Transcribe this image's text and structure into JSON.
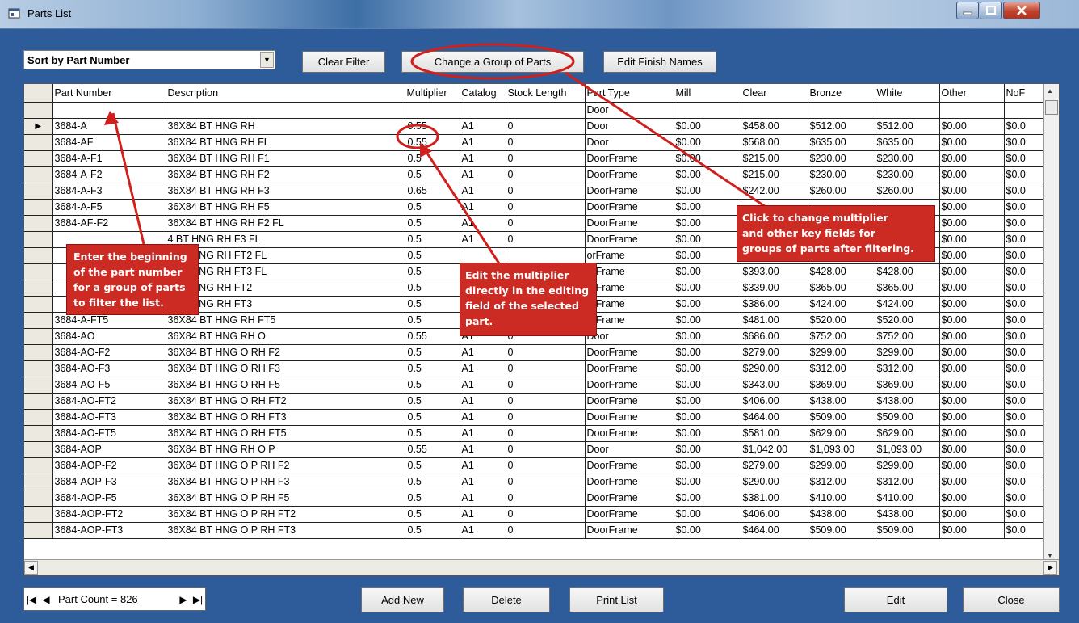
{
  "window": {
    "title": "Parts List"
  },
  "toolbar": {
    "sort_selected": "Sort by Part Number",
    "clear_filter": "Clear Filter",
    "change_group": "Change a Group of Parts",
    "edit_finish": "Edit Finish Names"
  },
  "grid": {
    "columns": [
      "Part Number",
      "Description",
      "Multiplier",
      "Catalog",
      "Stock Length",
      "Part Type",
      "Mill",
      "Clear",
      "Bronze",
      "White",
      "Other",
      "NoF"
    ],
    "filter_values": [
      "",
      "",
      "",
      "",
      "",
      "Door",
      "",
      "",
      "",
      "",
      "",
      ""
    ],
    "rows": [
      [
        "3684-A",
        "36X84 BT HNG RH",
        "0.55",
        "A1",
        "0",
        "Door",
        "$0.00",
        "$458.00",
        "$512.00",
        "$512.00",
        "$0.00",
        "$0.0"
      ],
      [
        "3684-AF",
        "36X84 BT HNG RH FL",
        "0.55",
        "A1",
        "0",
        "Door",
        "$0.00",
        "$568.00",
        "$635.00",
        "$635.00",
        "$0.00",
        "$0.0"
      ],
      [
        "3684-A-F1",
        "36X84 BT HNG RH F1",
        "0.5",
        "A1",
        "0",
        "DoorFrame",
        "$0.00",
        "$215.00",
        "$230.00",
        "$230.00",
        "$0.00",
        "$0.0"
      ],
      [
        "3684-A-F2",
        "36X84 BT HNG RH F2",
        "0.5",
        "A1",
        "0",
        "DoorFrame",
        "$0.00",
        "$215.00",
        "$230.00",
        "$230.00",
        "$0.00",
        "$0.0"
      ],
      [
        "3684-A-F3",
        "36X84 BT HNG RH F3",
        "0.65",
        "A1",
        "0",
        "DoorFrame",
        "$0.00",
        "$242.00",
        "$260.00",
        "$260.00",
        "$0.00",
        "$0.0"
      ],
      [
        "3684-A-F5",
        "36X84 BT HNG RH F5",
        "0.5",
        "A1",
        "0",
        "DoorFrame",
        "$0.00",
        "",
        "",
        "",
        "$0.00",
        "$0.0"
      ],
      [
        "3684-AF-F2",
        "36X84 BT HNG RH F2 FL",
        "0.5",
        "A1",
        "0",
        "DoorFrame",
        "$0.00",
        "",
        "",
        "",
        "$0.00",
        "$0.0"
      ],
      [
        "",
        "4 BT HNG RH F3 FL",
        "0.5",
        "A1",
        "0",
        "DoorFrame",
        "$0.00",
        "",
        "",
        "",
        "$0.00",
        "$0.0"
      ],
      [
        "",
        "4 BT HNG RH FT2 FL",
        "0.5",
        "",
        "",
        "orFrame",
        "$0.00",
        "$342.00",
        "$369.00",
        "$369.00",
        "$0.00",
        "$0.0"
      ],
      [
        "",
        "4 BT HNG RH FT3 FL",
        "0.5",
        "",
        "",
        "orFrame",
        "$0.00",
        "$393.00",
        "$428.00",
        "$428.00",
        "$0.00",
        "$0.0"
      ],
      [
        "",
        "4 BT HNG RH FT2",
        "0.5",
        "",
        "",
        "orFrame",
        "$0.00",
        "$339.00",
        "$365.00",
        "$365.00",
        "$0.00",
        "$0.0"
      ],
      [
        "",
        "4 BT HNG RH FT3",
        "0.5",
        "",
        "",
        "orFrame",
        "$0.00",
        "$386.00",
        "$424.00",
        "$424.00",
        "$0.00",
        "$0.0"
      ],
      [
        "3684-A-FT5",
        "36X84 BT HNG RH FT5",
        "0.5",
        "",
        "",
        "orFrame",
        "$0.00",
        "$481.00",
        "$520.00",
        "$520.00",
        "$0.00",
        "$0.0"
      ],
      [
        "3684-AO",
        "36X84 BT HNG RH O",
        "0.55",
        "A1",
        "0",
        "Door",
        "$0.00",
        "$686.00",
        "$752.00",
        "$752.00",
        "$0.00",
        "$0.0"
      ],
      [
        "3684-AO-F2",
        "36X84 BT HNG O RH F2",
        "0.5",
        "A1",
        "0",
        "DoorFrame",
        "$0.00",
        "$279.00",
        "$299.00",
        "$299.00",
        "$0.00",
        "$0.0"
      ],
      [
        "3684-AO-F3",
        "36X84 BT HNG O RH F3",
        "0.5",
        "A1",
        "0",
        "DoorFrame",
        "$0.00",
        "$290.00",
        "$312.00",
        "$312.00",
        "$0.00",
        "$0.0"
      ],
      [
        "3684-AO-F5",
        "36X84 BT HNG O RH F5",
        "0.5",
        "A1",
        "0",
        "DoorFrame",
        "$0.00",
        "$343.00",
        "$369.00",
        "$369.00",
        "$0.00",
        "$0.0"
      ],
      [
        "3684-AO-FT2",
        "36X84 BT HNG O RH FT2",
        "0.5",
        "A1",
        "0",
        "DoorFrame",
        "$0.00",
        "$406.00",
        "$438.00",
        "$438.00",
        "$0.00",
        "$0.0"
      ],
      [
        "3684-AO-FT3",
        "36X84 BT HNG O RH FT3",
        "0.5",
        "A1",
        "0",
        "DoorFrame",
        "$0.00",
        "$464.00",
        "$509.00",
        "$509.00",
        "$0.00",
        "$0.0"
      ],
      [
        "3684-AO-FT5",
        "36X84 BT HNG O RH FT5",
        "0.5",
        "A1",
        "0",
        "DoorFrame",
        "$0.00",
        "$581.00",
        "$629.00",
        "$629.00",
        "$0.00",
        "$0.0"
      ],
      [
        "3684-AOP",
        "36X84 BT HNG RH O P",
        "0.55",
        "A1",
        "0",
        "Door",
        "$0.00",
        "$1,042.00",
        "$1,093.00",
        "$1,093.00",
        "$0.00",
        "$0.0"
      ],
      [
        "3684-AOP-F2",
        "36X84 BT HNG O P RH F2",
        "0.5",
        "A1",
        "0",
        "DoorFrame",
        "$0.00",
        "$279.00",
        "$299.00",
        "$299.00",
        "$0.00",
        "$0.0"
      ],
      [
        "3684-AOP-F3",
        "36X84 BT HNG O P RH F3",
        "0.5",
        "A1",
        "0",
        "DoorFrame",
        "$0.00",
        "$290.00",
        "$312.00",
        "$312.00",
        "$0.00",
        "$0.0"
      ],
      [
        "3684-AOP-F5",
        "36X84 BT HNG O P RH F5",
        "0.5",
        "A1",
        "0",
        "DoorFrame",
        "$0.00",
        "$381.00",
        "$410.00",
        "$410.00",
        "$0.00",
        "$0.0"
      ],
      [
        "3684-AOP-FT2",
        "36X84 BT HNG O P RH FT2",
        "0.5",
        "A1",
        "0",
        "DoorFrame",
        "$0.00",
        "$406.00",
        "$438.00",
        "$438.00",
        "$0.00",
        "$0.0"
      ],
      [
        "3684-AOP-FT3",
        "36X84 BT HNG O P RH FT3",
        "0.5",
        "A1",
        "0",
        "DoorFrame",
        "$0.00",
        "$464.00",
        "$509.00",
        "$509.00",
        "$0.00",
        "$0.0"
      ]
    ]
  },
  "nav": {
    "part_count": "Part Count = 826"
  },
  "buttons": {
    "add_new": "Add New",
    "delete": "Delete",
    "print_list": "Print List",
    "edit": "Edit",
    "close": "Close"
  },
  "annotations": {
    "filter": "Enter the beginning\nof the part number\nfor a group of parts\nto filter the list.",
    "multiplier": "Edit the multiplier\ndirectly in the editing\nfield of the selected\npart.",
    "group": "Click to change multiplier\nand other key fields for\ngroups of parts after filtering."
  },
  "colors": {
    "window_bg": "#2e5b99",
    "annotation_red": "#cc2b24"
  }
}
